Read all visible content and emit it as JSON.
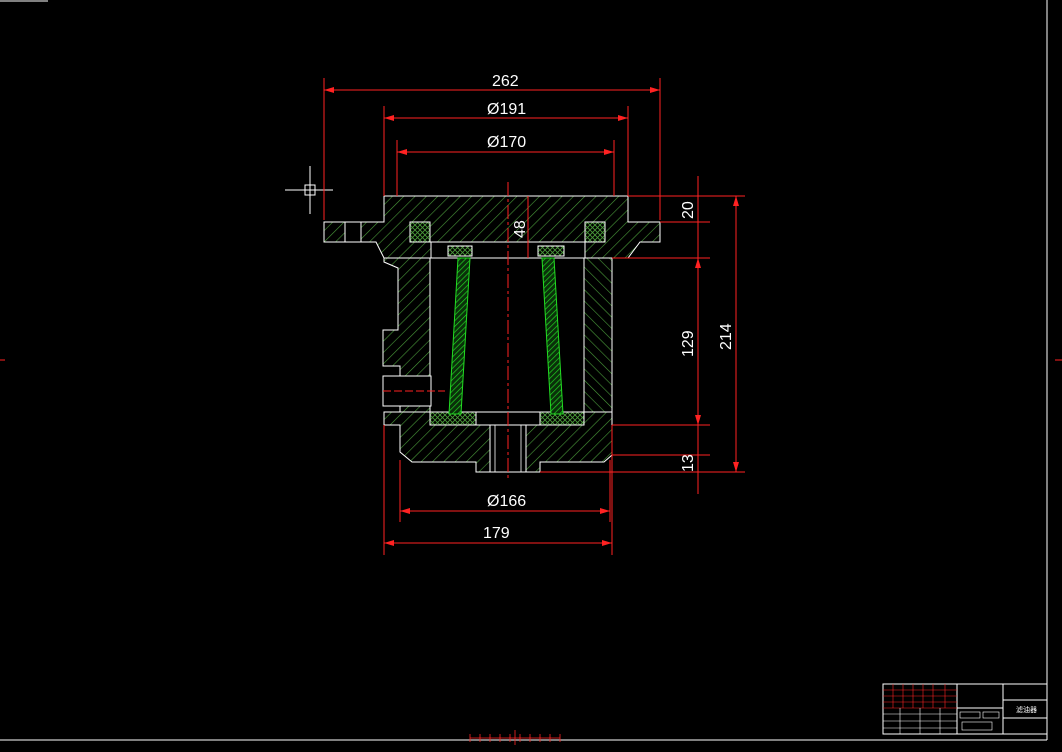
{
  "drawing": {
    "dimensions": {
      "overall_width": "262",
      "dia_191": "Ø191",
      "dia_170": "Ø170",
      "height_48": "48",
      "height_20": "20",
      "height_129": "129",
      "height_214": "214",
      "height_13": "13",
      "dia_166": "Ø166",
      "width_179": "179"
    },
    "title_block": {
      "part_name": "滤油器"
    }
  },
  "colors": {
    "background": "#000000",
    "outline": "#ffffff",
    "hatch_body": "#4a9a3a",
    "hatch_insert": "#22dd22",
    "dimension": "#ff2222",
    "frame": "#ffffff"
  }
}
